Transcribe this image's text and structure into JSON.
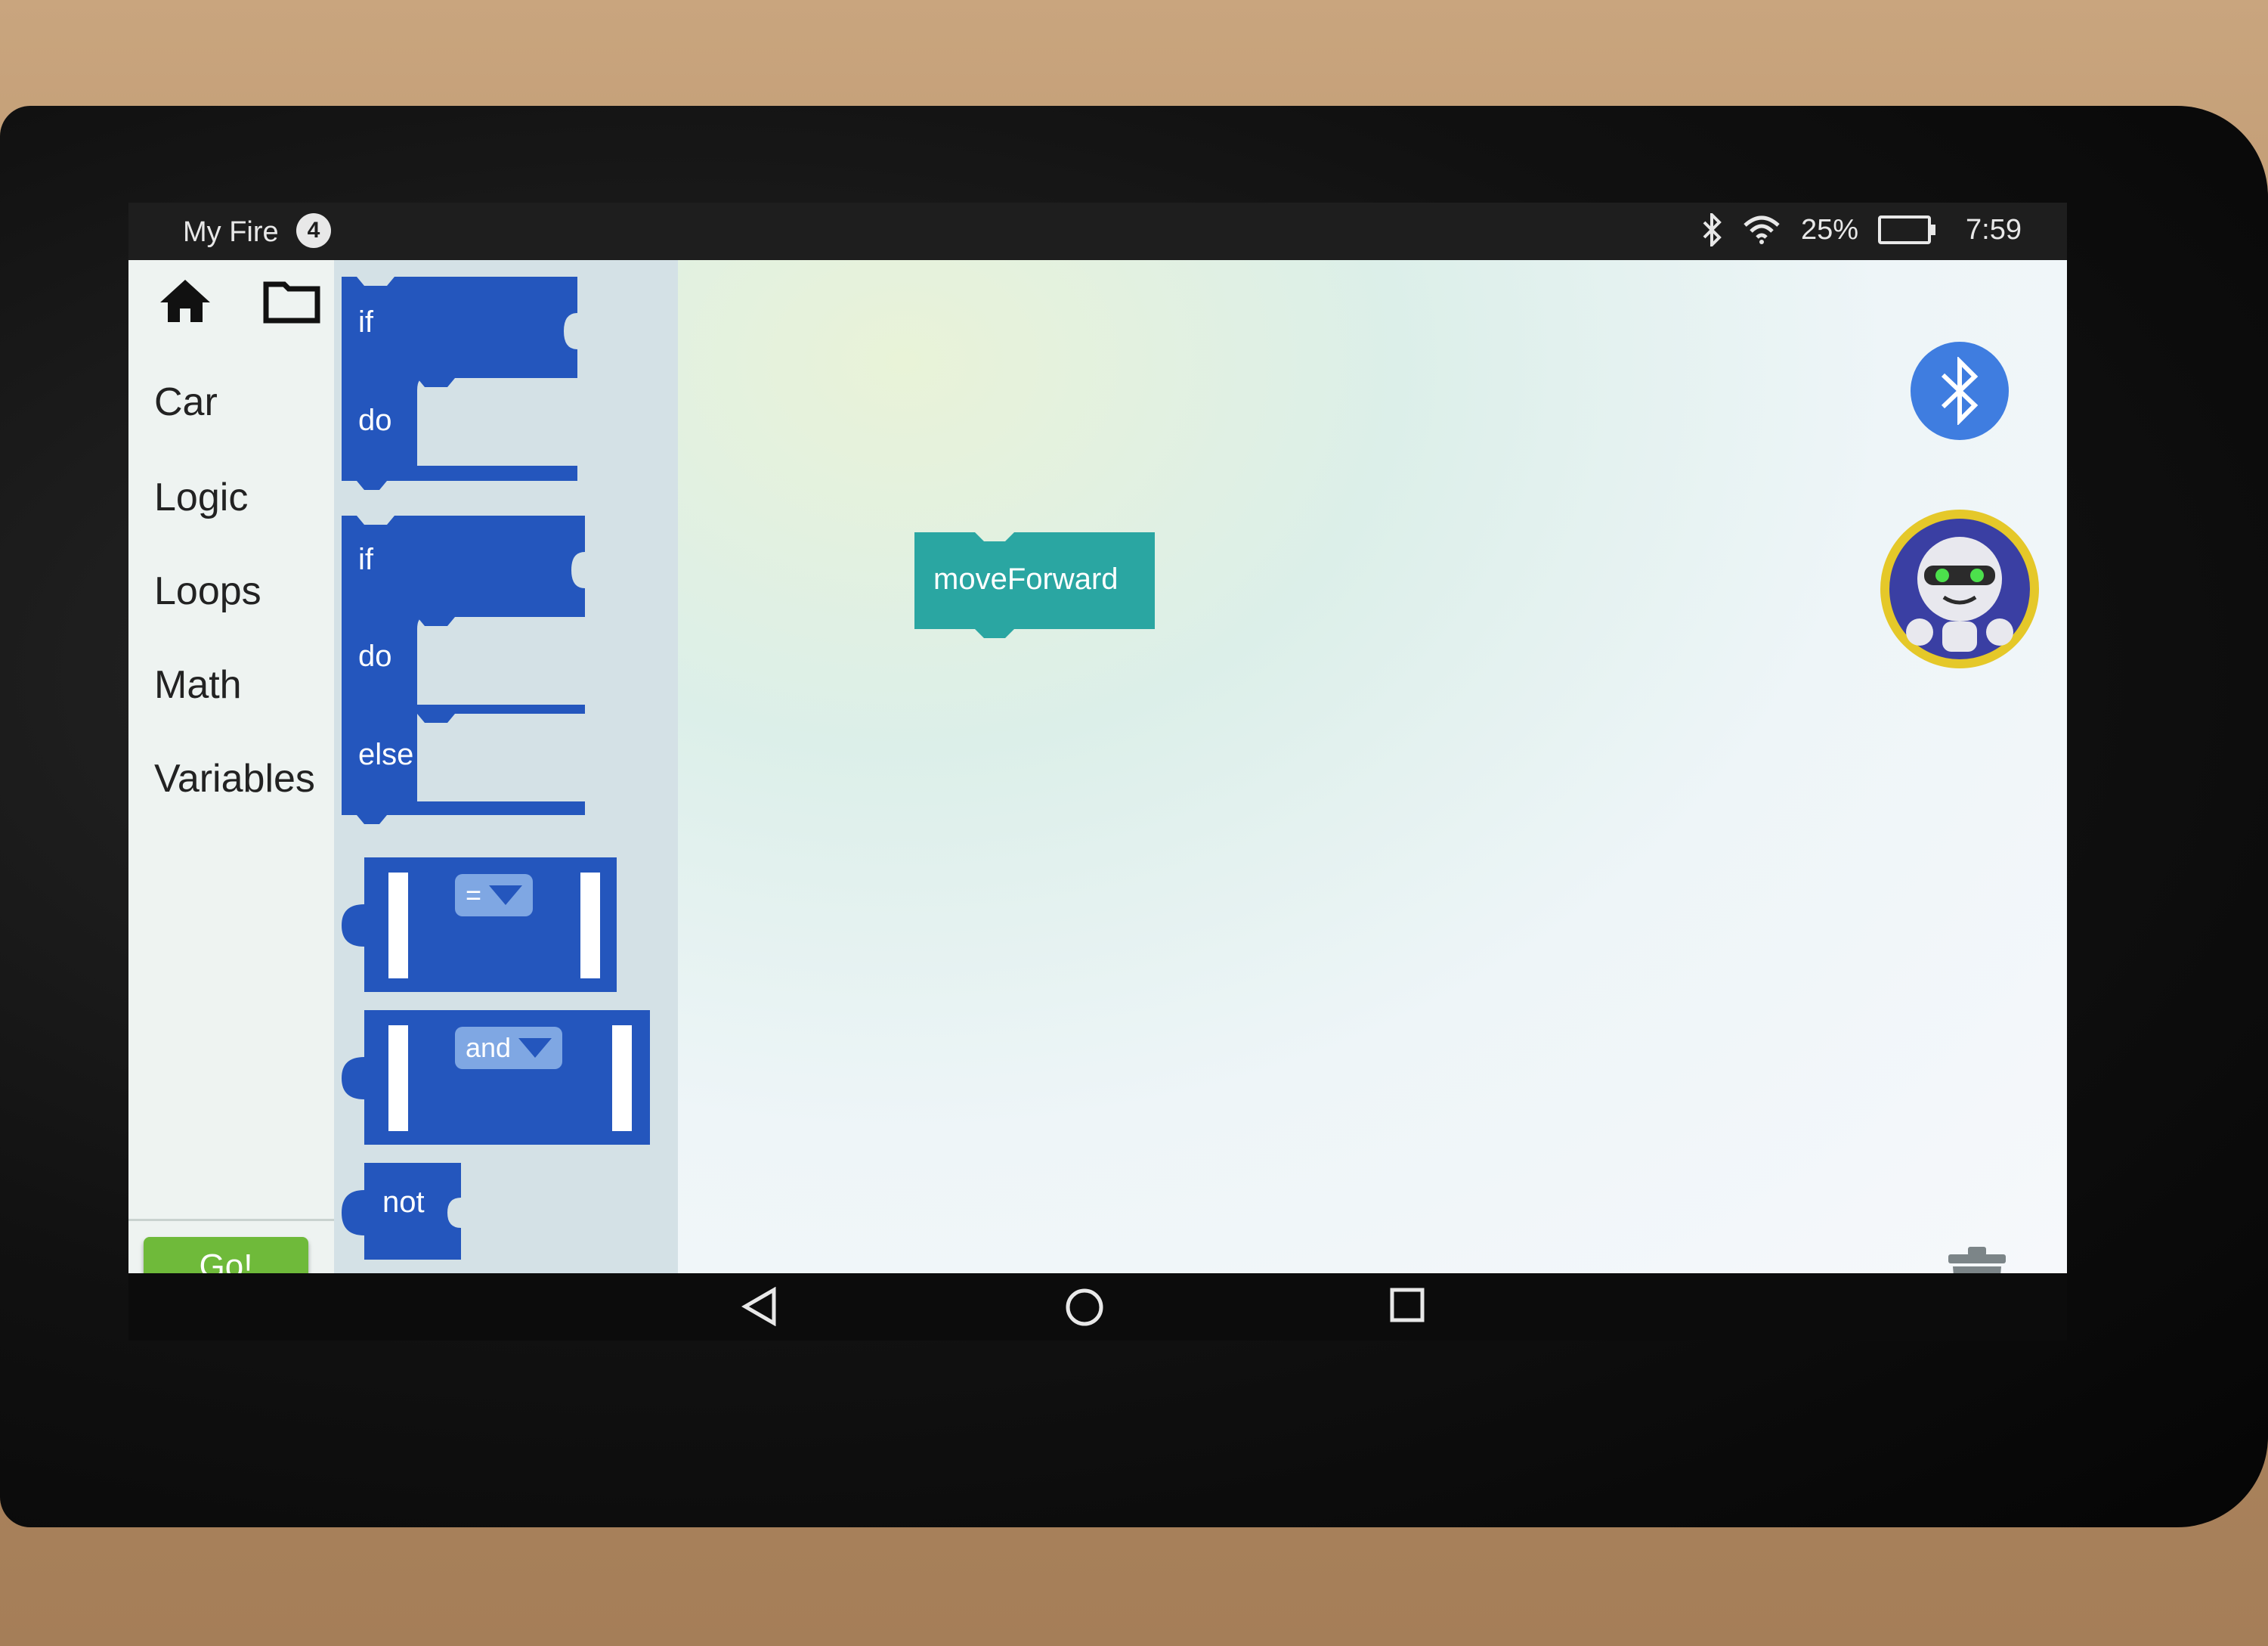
{
  "status_bar": {
    "title": "My Fire",
    "notification_count": "4",
    "battery_percent": "25%",
    "time": "7:59",
    "icons": [
      "bluetooth-icon",
      "wifi-icon",
      "battery-icon"
    ]
  },
  "sidebar": {
    "icons": [
      "home-icon",
      "folder-icon"
    ],
    "categories": [
      "Car",
      "Logic",
      "Loops",
      "Math",
      "Variables"
    ],
    "go_label": "Go!"
  },
  "flyout": {
    "if_do": {
      "if": "if",
      "do": "do"
    },
    "if_do_else": {
      "if": "if",
      "do": "do",
      "else": "else"
    },
    "compare": {
      "operator": "="
    },
    "logic_op": {
      "operator": "and"
    },
    "negate": {
      "label": "not"
    },
    "boolean": {
      "value": "true"
    }
  },
  "workspace": {
    "block_label": "moveForward",
    "buttons": [
      "bluetooth-button",
      "robot-avatar",
      "trash-icon"
    ]
  },
  "colors": {
    "block_blue": "#2456bd",
    "block_teal": "#2aa6a2",
    "go_green": "#6fba3a",
    "bluetooth_blue": "#3f7de0",
    "avatar_ring": "#e5c829"
  },
  "nav_bar": [
    "back-icon",
    "home-circle-icon",
    "recents-icon"
  ]
}
